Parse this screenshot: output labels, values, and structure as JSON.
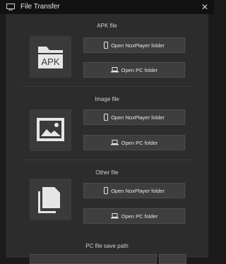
{
  "window": {
    "title": "File Transfer",
    "close_glyph": "✕"
  },
  "sections": [
    {
      "title": "APK file",
      "thumb_text": "APK",
      "thumb_icon": "apk-folder-icon",
      "nox_label": "Open NoxPlayer folder",
      "pc_label": "Open PC folder"
    },
    {
      "title": "Image file",
      "thumb_icon": "image-file-icon",
      "nox_label": "Open NoxPlayer folder",
      "pc_label": "Open PC folder"
    },
    {
      "title": "Other file",
      "thumb_icon": "documents-icon",
      "nox_label": "Open NoxPlayer folder",
      "pc_label": "Open PC folder"
    }
  ],
  "save_path": {
    "label": "PC file save path",
    "value": ""
  },
  "colors": {
    "background": "#1b1b1b",
    "panel": "#2c2c2c",
    "button": "#3e3e3e",
    "icon": "#e6e6e6"
  }
}
